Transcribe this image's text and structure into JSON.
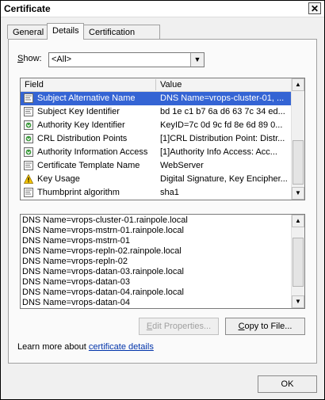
{
  "window": {
    "title": "Certificate",
    "close_glyph": "✕"
  },
  "tabs": [
    {
      "label": "General"
    },
    {
      "label": "Details"
    },
    {
      "label": "Certification Path"
    }
  ],
  "show": {
    "label_prefix": "",
    "label_key": "S",
    "label_rest": "how:",
    "value": "<All>",
    "dropdown_icon": "chevron-down-icon"
  },
  "fields_table": {
    "columns": [
      "Field",
      "Value"
    ],
    "rows": [
      {
        "icon": "cert-field-icon",
        "field": "Subject Alternative Name",
        "value": "DNS Name=vrops-cluster-01, ...",
        "selected": true
      },
      {
        "icon": "cert-field-icon",
        "field": "Subject Key Identifier",
        "value": "bd 1e c1 b7 6a d6 63 7c 34 ed..."
      },
      {
        "icon": "cert-extension-icon",
        "field": "Authority Key Identifier",
        "value": "KeyID=7c 0d 9c fd 8e 6d 89 0..."
      },
      {
        "icon": "cert-extension-icon",
        "field": "CRL Distribution Points",
        "value": "[1]CRL Distribution Point: Distr..."
      },
      {
        "icon": "cert-extension-icon",
        "field": "Authority Information Access",
        "value": "[1]Authority Info Access: Acc..."
      },
      {
        "icon": "cert-field-icon",
        "field": "Certificate Template Name",
        "value": "WebServer"
      },
      {
        "icon": "warning-icon",
        "field": "Key Usage",
        "value": "Digital Signature, Key Encipher..."
      },
      {
        "icon": "cert-field-icon",
        "field": "Thumbprint algorithm",
        "value": "sha1"
      }
    ]
  },
  "detail_text": [
    "DNS Name=vrops-cluster-01.rainpole.local",
    "DNS Name=vrops-mstrn-01.rainpole.local",
    "DNS Name=vrops-mstrn-01",
    "DNS Name=vrops-repln-02.rainpole.local",
    "DNS Name=vrops-repln-02",
    "DNS Name=vrops-datan-03.rainpole.local",
    "DNS Name=vrops-datan-03",
    "DNS Name=vrops-datan-04.rainpole.local",
    "DNS Name=vrops-datan-04"
  ],
  "buttons": {
    "edit_properties": {
      "key": "E",
      "rest": "dit Properties..."
    },
    "copy_to_file": {
      "key": "C",
      "rest": "opy to File..."
    },
    "ok": "OK"
  },
  "learn_more": {
    "prefix": "Learn more about ",
    "link": "certificate details"
  },
  "colors": {
    "selection": "#3464d4",
    "link": "#0033aa",
    "disabled_text": "#a0a0a0"
  }
}
